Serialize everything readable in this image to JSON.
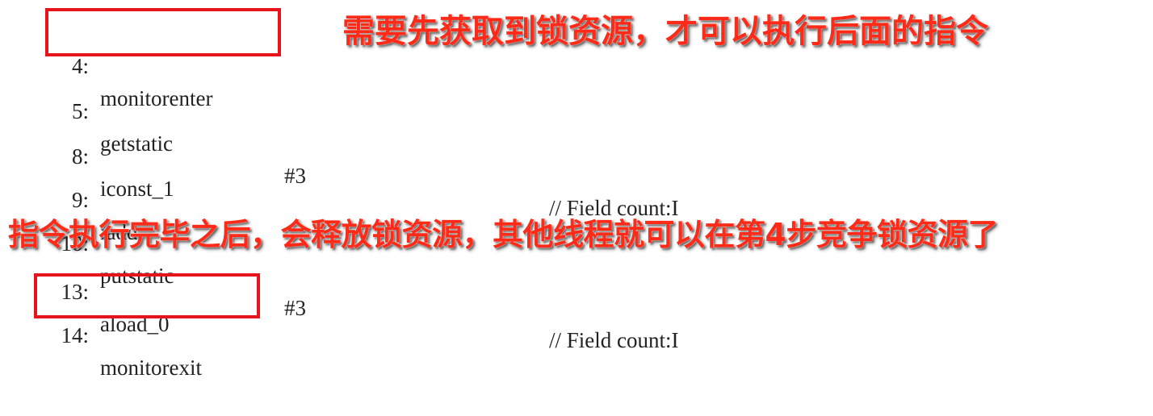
{
  "code_lines": [
    {
      "num": "4:",
      "op": "monitorenter",
      "arg": "",
      "comment": ""
    },
    {
      "num": "5:",
      "op": "getstatic",
      "arg": "#3",
      "comment": "// Field count:I"
    },
    {
      "num": "8:",
      "op": "iconst_1",
      "arg": "",
      "comment": ""
    },
    {
      "num": "9:",
      "op": "iadd",
      "arg": "",
      "comment": ""
    },
    {
      "num": "10:",
      "op": "putstatic",
      "arg": "#3",
      "comment": "// Field count:I"
    },
    {
      "num": "13:",
      "op": "aload_0",
      "arg": "",
      "comment": ""
    },
    {
      "num": "14:",
      "op": "monitorexit",
      "arg": "",
      "comment": ""
    }
  ],
  "annotations": {
    "top": "需要先获取到锁资源，才可以执行后面的指令",
    "middle": "指令执行完毕之后，会释放锁资源，其他线程就可以在第4步竞争锁资源了"
  },
  "colors": {
    "highlight_box": "#e8141b",
    "annotation_text": "#ff2a17",
    "code_text": "#222222",
    "background": "#ffffff"
  }
}
